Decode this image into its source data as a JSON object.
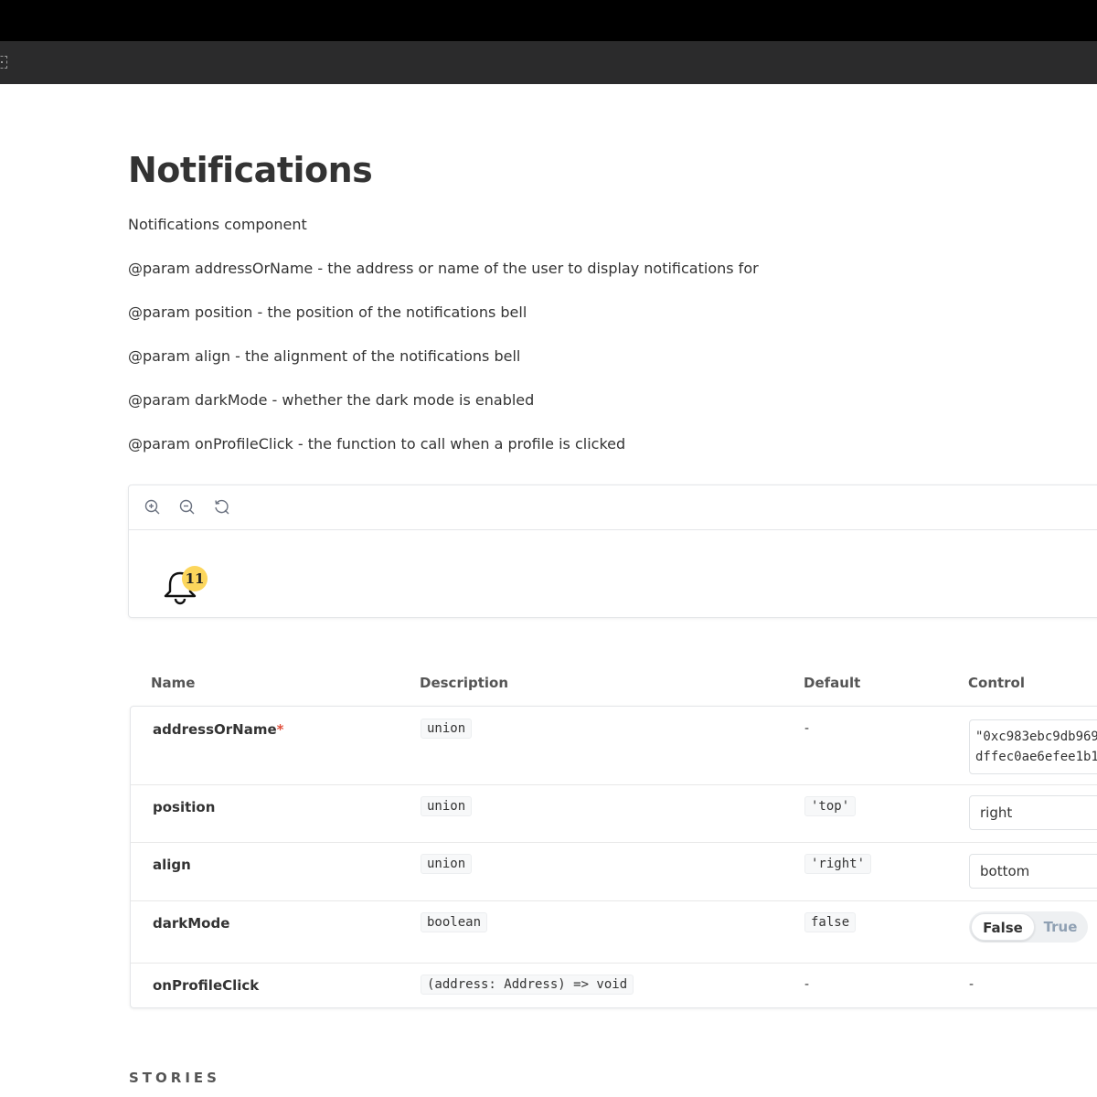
{
  "page": {
    "title": "Notifications",
    "description": "Notifications component",
    "params": [
      "@param addressOrName - the address or name of the user to display notifications for",
      "@param position - the position of the notifications bell",
      "@param align - the alignment of the notifications bell",
      "@param darkMode - whether the dark mode is enabled",
      "@param onProfileClick - the function to call when a profile is clicked"
    ]
  },
  "preview": {
    "toolbar": [
      "zoom-in-icon",
      "zoom-out-icon",
      "reset-zoom-icon"
    ],
    "badge_count": "11"
  },
  "args_table": {
    "headers": {
      "name": "Name",
      "description": "Description",
      "default": "Default",
      "control": "Control"
    },
    "rows": [
      {
        "name": "addressOrName",
        "required_mark": "*",
        "type": "union",
        "default": "-",
        "control_value": "\"0xc983ebc9db969\ndffec0ae6efee1b1"
      },
      {
        "name": "position",
        "type": "union",
        "default": "'top'",
        "control_value": "right"
      },
      {
        "name": "align",
        "type": "union",
        "default": "'right'",
        "control_value": "bottom"
      },
      {
        "name": "darkMode",
        "type": "boolean",
        "default": "false",
        "toggle_false": "False",
        "toggle_true": "True"
      },
      {
        "name": "onProfileClick",
        "type": "(address: Address) => void",
        "default": "-",
        "control_value": "-"
      }
    ]
  },
  "section": {
    "stories": "STORIES"
  }
}
